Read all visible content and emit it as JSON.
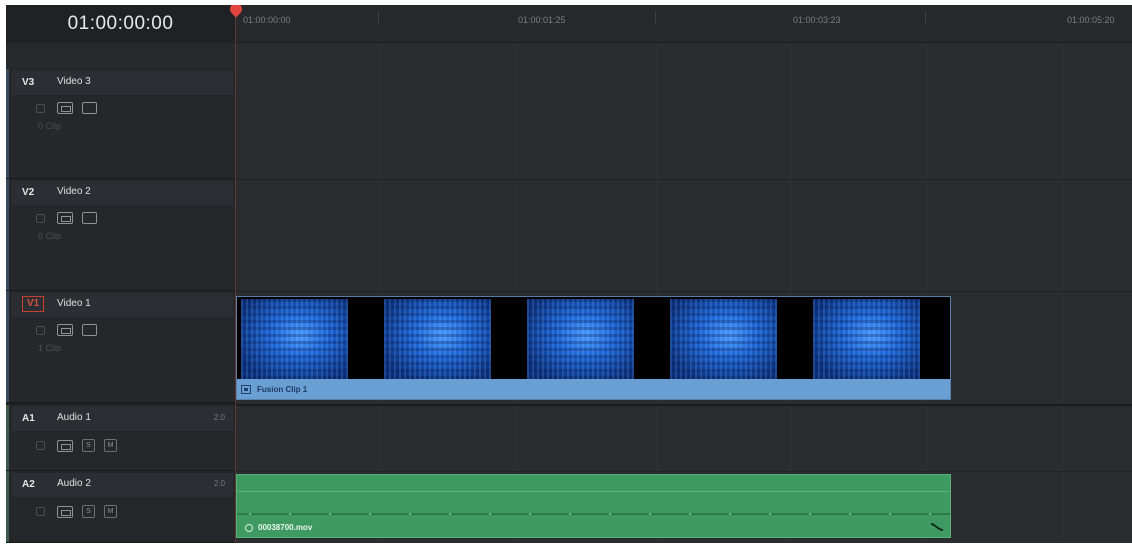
{
  "timecode": "01:00:00:00",
  "ruler": {
    "labels": [
      "01:00:00:00",
      "01:00:01:25",
      "01:00:03:23",
      "01:00:05:20"
    ]
  },
  "tracks": {
    "v3": {
      "id": "V3",
      "name": "Video 3",
      "clips": "0 Clip"
    },
    "v2": {
      "id": "V2",
      "name": "Video 2",
      "clips": "0 Clip"
    },
    "v1": {
      "id": "V1",
      "name": "Video 1",
      "clips": "1 Clip"
    },
    "a1": {
      "id": "A1",
      "name": "Audio 1",
      "level": "2.0",
      "s": "S",
      "m": "M"
    },
    "a2": {
      "id": "A2",
      "name": "Audio 2",
      "level": "2.0",
      "s": "S",
      "m": "M"
    }
  },
  "clips": {
    "video": {
      "name": "Fusion Clip 1"
    },
    "audio": {
      "name": "00038700.mov"
    }
  },
  "colors": {
    "background": "#2a2c30",
    "playhead": "#e0443c",
    "video_clip": "#6a9fd4",
    "audio_clip": "#3f9a62",
    "active_track": "#c4432f"
  },
  "icons": [
    "lock-icon",
    "auto-select-icon",
    "monitor-icon",
    "fusion-clip-icon",
    "link-icon",
    "curve-icon"
  ]
}
